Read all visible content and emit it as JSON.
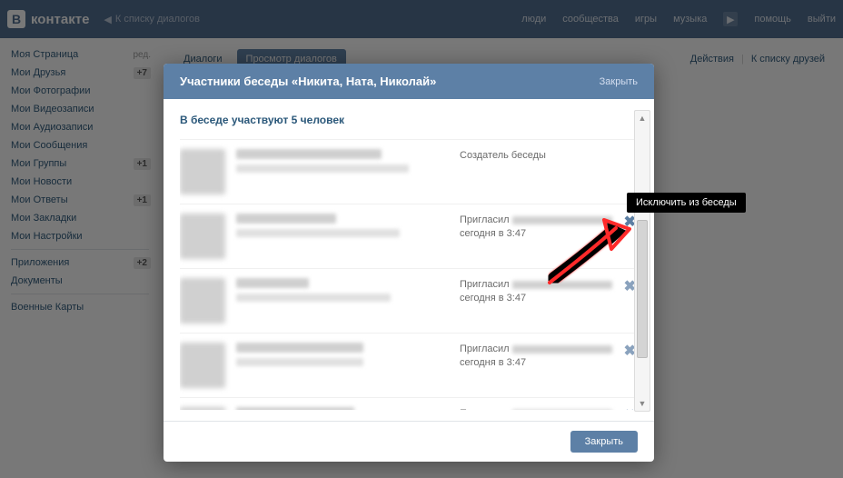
{
  "header": {
    "logo_text": "контакте",
    "logo_letter": "В",
    "back_label": "К списку диалогов",
    "nav": {
      "people": "люди",
      "communities": "сообщества",
      "games": "игры",
      "music": "музыка",
      "help": "помощь",
      "logout": "выйти"
    }
  },
  "sidebar": {
    "items": [
      {
        "label": "Моя Страница",
        "extra": "ред."
      },
      {
        "label": "Мои Друзья",
        "badge": "+7"
      },
      {
        "label": "Мои Фотографии"
      },
      {
        "label": "Мои Видеозаписи"
      },
      {
        "label": "Мои Аудиозаписи"
      },
      {
        "label": "Мои Сообщения"
      },
      {
        "label": "Мои Группы",
        "badge": "+1"
      },
      {
        "label": "Мои Новости"
      },
      {
        "label": "Мои Ответы",
        "badge": "+1"
      },
      {
        "label": "Мои Закладки"
      },
      {
        "label": "Мои Настройки"
      }
    ],
    "sec2": [
      {
        "label": "Приложения",
        "badge": "+2"
      },
      {
        "label": "Документы"
      }
    ],
    "sec3": [
      {
        "label": "Военные Карты"
      }
    ]
  },
  "tabs": {
    "dialogs": "Диалоги",
    "view": "Просмотр диалогов",
    "actions": "Действия",
    "to_friends": "К списку друзей"
  },
  "modal": {
    "title": "Участники беседы «Никита, Ната, Николай»",
    "close": "Закрыть",
    "sub": "В беседе участвуют 5 человек",
    "creator": "Создатель беседы",
    "invited_prefix": "Пригласил",
    "time": "сегодня в 3:47",
    "tooltip": "Исключить из беседы",
    "footer_btn": "Закрыть"
  }
}
